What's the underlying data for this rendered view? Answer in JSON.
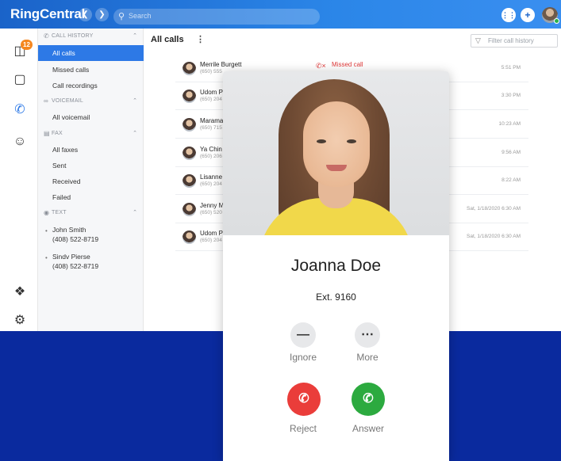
{
  "app": {
    "brand": "RingCentral",
    "search_placeholder": "Search"
  },
  "rail": {
    "badge_count": "12",
    "icons": [
      "messages-icon",
      "video-icon",
      "phone-icon",
      "contacts-icon",
      "apps-icon",
      "settings-icon"
    ]
  },
  "sidebar": {
    "call_history_header": "CALL HISTORY",
    "call_history_items": [
      "All calls",
      "Missed calls",
      "Call recordings"
    ],
    "voicemail_header": "VOICEMAIL",
    "voicemail_items": [
      "All voicemail"
    ],
    "fax_header": "FAX",
    "fax_items": [
      "All faxes",
      "Sent",
      "Received",
      "Failed"
    ],
    "text_header": "TEXT",
    "text_contacts": [
      {
        "name": "John Smith",
        "phone": "(408) 522-8719"
      },
      {
        "name": "Sindv Pierse",
        "phone": "(408) 522-8719"
      }
    ]
  },
  "main": {
    "title": "All calls",
    "filter_placeholder": "Filter call history",
    "calls": [
      {
        "name": "Merrile Burgett",
        "phone": "(650) 555",
        "status": "Missed call",
        "time": "5:51 PM"
      },
      {
        "name": "Udom P",
        "phone": "(650) 204",
        "status": "",
        "time": "3:30 PM"
      },
      {
        "name": "Marama",
        "phone": "(650) 715",
        "status": "",
        "time": "10:23 AM"
      },
      {
        "name": "Ya Chin",
        "phone": "(650) 206",
        "status": "",
        "time": "9:56 AM"
      },
      {
        "name": "Lisanne",
        "phone": "(650) 204",
        "status": "",
        "time": "8:22 AM"
      },
      {
        "name": "Jenny M",
        "phone": "(650) 520",
        "status": "",
        "time": "Sat, 1/18/2020 6:30 AM"
      },
      {
        "name": "Udom P",
        "phone": "(650) 204",
        "status": "",
        "time": "Sat, 1/18/2020 6:30 AM"
      }
    ]
  },
  "incoming": {
    "caller_name": "Joanna Doe",
    "extension": "Ext. 9160",
    "ignore_label": "Ignore",
    "more_label": "More",
    "reject_label": "Reject",
    "answer_label": "Answer"
  },
  "colors": {
    "brand_blue": "#2b86e8",
    "selected_blue": "#2d79e6",
    "background_band": "#0a2a9e",
    "reject_red": "#ea3d3a",
    "answer_green": "#2caa3f",
    "missed_red": "#e03a3a",
    "badge_orange": "#f5871f"
  }
}
